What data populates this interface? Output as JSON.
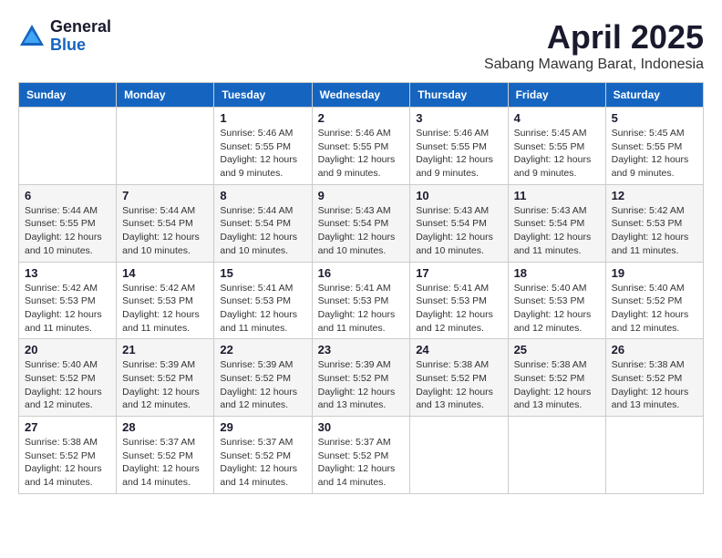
{
  "logo": {
    "general": "General",
    "blue": "Blue"
  },
  "title": "April 2025",
  "subtitle": "Sabang Mawang Barat, Indonesia",
  "days_of_week": [
    "Sunday",
    "Monday",
    "Tuesday",
    "Wednesday",
    "Thursday",
    "Friday",
    "Saturday"
  ],
  "weeks": [
    [
      {
        "day": "",
        "info": ""
      },
      {
        "day": "",
        "info": ""
      },
      {
        "day": "1",
        "info": "Sunrise: 5:46 AM\nSunset: 5:55 PM\nDaylight: 12 hours and 9 minutes."
      },
      {
        "day": "2",
        "info": "Sunrise: 5:46 AM\nSunset: 5:55 PM\nDaylight: 12 hours and 9 minutes."
      },
      {
        "day": "3",
        "info": "Sunrise: 5:46 AM\nSunset: 5:55 PM\nDaylight: 12 hours and 9 minutes."
      },
      {
        "day": "4",
        "info": "Sunrise: 5:45 AM\nSunset: 5:55 PM\nDaylight: 12 hours and 9 minutes."
      },
      {
        "day": "5",
        "info": "Sunrise: 5:45 AM\nSunset: 5:55 PM\nDaylight: 12 hours and 9 minutes."
      }
    ],
    [
      {
        "day": "6",
        "info": "Sunrise: 5:44 AM\nSunset: 5:55 PM\nDaylight: 12 hours and 10 minutes."
      },
      {
        "day": "7",
        "info": "Sunrise: 5:44 AM\nSunset: 5:54 PM\nDaylight: 12 hours and 10 minutes."
      },
      {
        "day": "8",
        "info": "Sunrise: 5:44 AM\nSunset: 5:54 PM\nDaylight: 12 hours and 10 minutes."
      },
      {
        "day": "9",
        "info": "Sunrise: 5:43 AM\nSunset: 5:54 PM\nDaylight: 12 hours and 10 minutes."
      },
      {
        "day": "10",
        "info": "Sunrise: 5:43 AM\nSunset: 5:54 PM\nDaylight: 12 hours and 10 minutes."
      },
      {
        "day": "11",
        "info": "Sunrise: 5:43 AM\nSunset: 5:54 PM\nDaylight: 12 hours and 11 minutes."
      },
      {
        "day": "12",
        "info": "Sunrise: 5:42 AM\nSunset: 5:53 PM\nDaylight: 12 hours and 11 minutes."
      }
    ],
    [
      {
        "day": "13",
        "info": "Sunrise: 5:42 AM\nSunset: 5:53 PM\nDaylight: 12 hours and 11 minutes."
      },
      {
        "day": "14",
        "info": "Sunrise: 5:42 AM\nSunset: 5:53 PM\nDaylight: 12 hours and 11 minutes."
      },
      {
        "day": "15",
        "info": "Sunrise: 5:41 AM\nSunset: 5:53 PM\nDaylight: 12 hours and 11 minutes."
      },
      {
        "day": "16",
        "info": "Sunrise: 5:41 AM\nSunset: 5:53 PM\nDaylight: 12 hours and 11 minutes."
      },
      {
        "day": "17",
        "info": "Sunrise: 5:41 AM\nSunset: 5:53 PM\nDaylight: 12 hours and 12 minutes."
      },
      {
        "day": "18",
        "info": "Sunrise: 5:40 AM\nSunset: 5:53 PM\nDaylight: 12 hours and 12 minutes."
      },
      {
        "day": "19",
        "info": "Sunrise: 5:40 AM\nSunset: 5:52 PM\nDaylight: 12 hours and 12 minutes."
      }
    ],
    [
      {
        "day": "20",
        "info": "Sunrise: 5:40 AM\nSunset: 5:52 PM\nDaylight: 12 hours and 12 minutes."
      },
      {
        "day": "21",
        "info": "Sunrise: 5:39 AM\nSunset: 5:52 PM\nDaylight: 12 hours and 12 minutes."
      },
      {
        "day": "22",
        "info": "Sunrise: 5:39 AM\nSunset: 5:52 PM\nDaylight: 12 hours and 12 minutes."
      },
      {
        "day": "23",
        "info": "Sunrise: 5:39 AM\nSunset: 5:52 PM\nDaylight: 12 hours and 13 minutes."
      },
      {
        "day": "24",
        "info": "Sunrise: 5:38 AM\nSunset: 5:52 PM\nDaylight: 12 hours and 13 minutes."
      },
      {
        "day": "25",
        "info": "Sunrise: 5:38 AM\nSunset: 5:52 PM\nDaylight: 12 hours and 13 minutes."
      },
      {
        "day": "26",
        "info": "Sunrise: 5:38 AM\nSunset: 5:52 PM\nDaylight: 12 hours and 13 minutes."
      }
    ],
    [
      {
        "day": "27",
        "info": "Sunrise: 5:38 AM\nSunset: 5:52 PM\nDaylight: 12 hours and 14 minutes."
      },
      {
        "day": "28",
        "info": "Sunrise: 5:37 AM\nSunset: 5:52 PM\nDaylight: 12 hours and 14 minutes."
      },
      {
        "day": "29",
        "info": "Sunrise: 5:37 AM\nSunset: 5:52 PM\nDaylight: 12 hours and 14 minutes."
      },
      {
        "day": "30",
        "info": "Sunrise: 5:37 AM\nSunset: 5:52 PM\nDaylight: 12 hours and 14 minutes."
      },
      {
        "day": "",
        "info": ""
      },
      {
        "day": "",
        "info": ""
      },
      {
        "day": "",
        "info": ""
      }
    ]
  ]
}
